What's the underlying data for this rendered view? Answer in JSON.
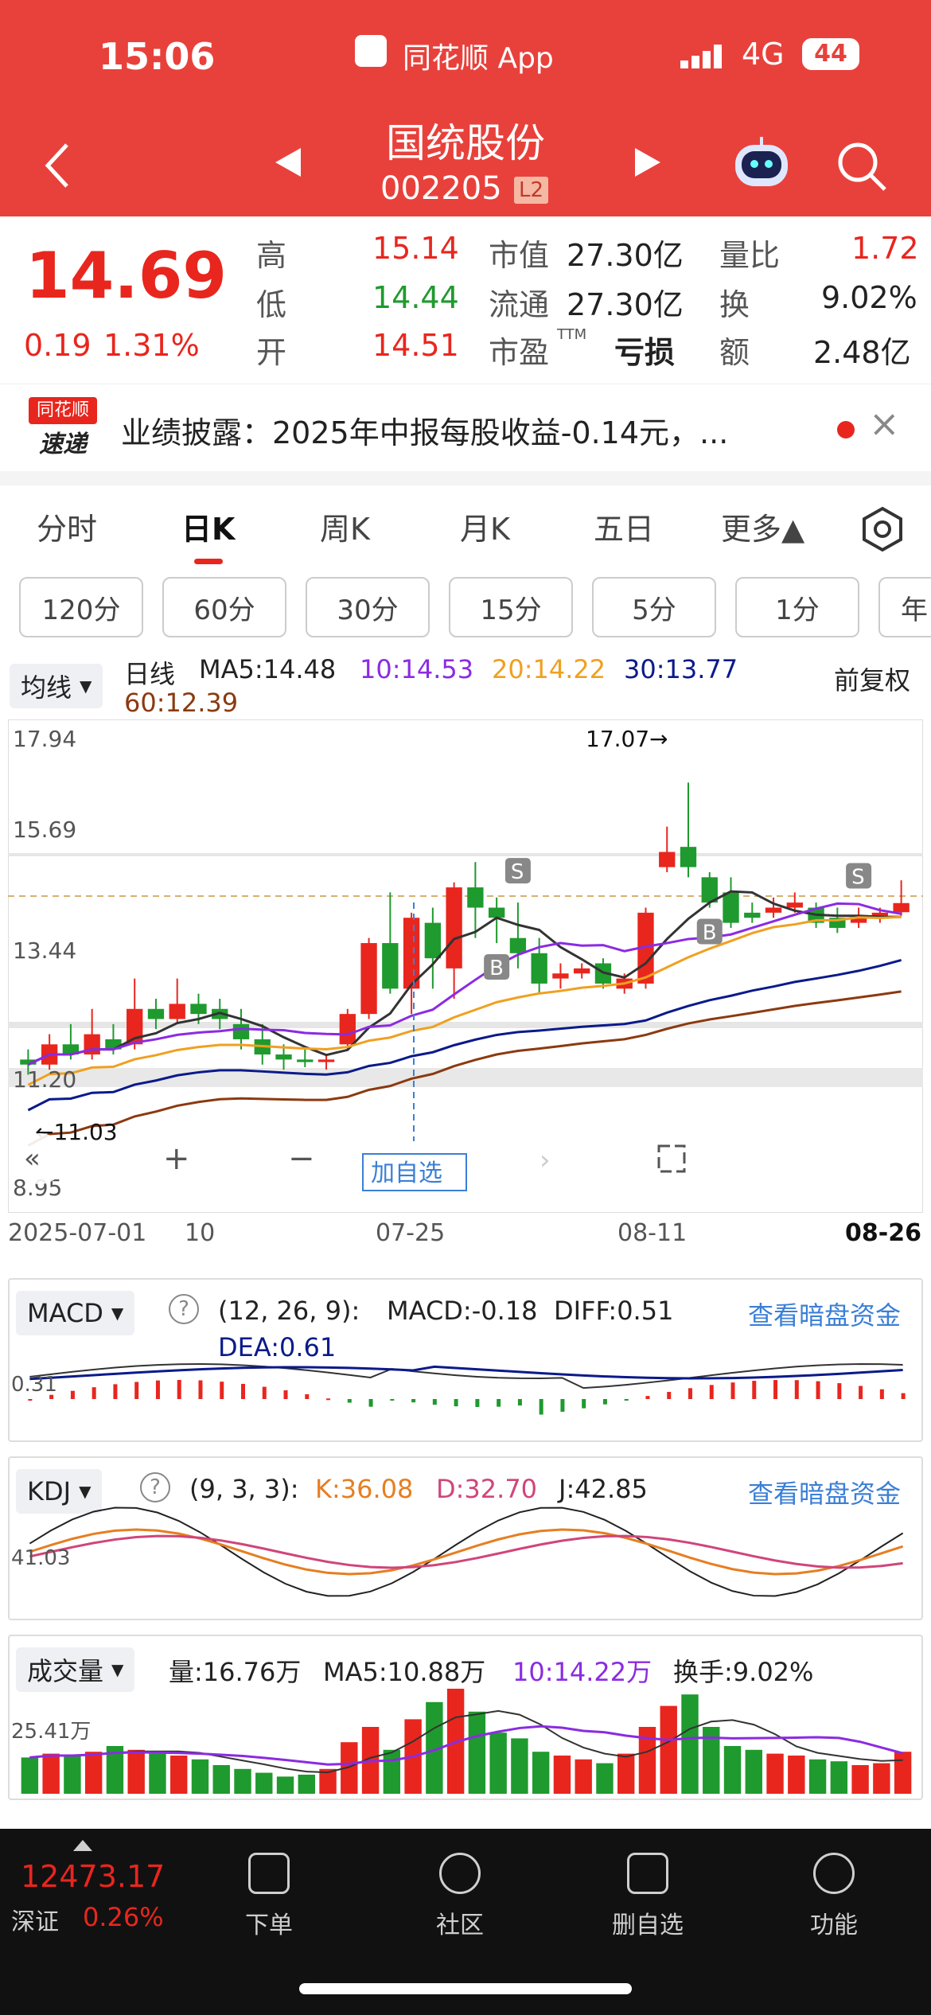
{
  "status": {
    "time": "15:06",
    "app": "同花顺 App",
    "network": "4G",
    "battery": "44"
  },
  "header": {
    "stock_name": "国统股份",
    "stock_code": "002205",
    "level": "L2"
  },
  "quote": {
    "price": "14.69",
    "change": "0.19",
    "change_pct": "1.31%",
    "high_label": "高",
    "high": "15.14",
    "low_label": "低",
    "low": "14.44",
    "open_label": "开",
    "open": "14.51",
    "mcap_label": "市值",
    "mcap": "27.30亿",
    "float_label": "流通",
    "float": "27.30亿",
    "pe_label": "市盈",
    "pe_sup": "TTM",
    "pe": "亏损",
    "vol_ratio_label": "量比",
    "vol_ratio": "1.72",
    "turnover_label": "换",
    "turnover": "9.02%",
    "amount_label": "额",
    "amount": "2.48亿"
  },
  "news": {
    "logo_top": "同花顺",
    "logo_bottom": "速递",
    "text": "业绩披露：2025年中报每股收益-0.14元，...",
    "close": "×"
  },
  "tabs": [
    "分时",
    "日K",
    "周K",
    "月K",
    "五日",
    "更多▲"
  ],
  "periods": [
    "120分",
    "60分",
    "30分",
    "15分",
    "5分",
    "1分",
    "年"
  ],
  "ma_bar": {
    "selector": "均线",
    "line": "日线",
    "ma5": "MA5:14.48",
    "ma10": "10:14.53",
    "ma20": "20:14.22",
    "ma30": "30:13.77",
    "ma60": "60:12.39",
    "adjust": "前复权"
  },
  "colors": {
    "up": "#e8261e",
    "down": "#1f9a2e",
    "ma5": "#333333",
    "ma10": "#8b2be2",
    "ma20": "#f0a020",
    "ma30": "#0a1a8a",
    "ma60": "#8b3a10",
    "header": "#e8413b"
  },
  "chart_data": {
    "type": "candlestick",
    "y_labels": [
      "17.94",
      "15.69",
      "13.44",
      "11.20",
      "8.95"
    ],
    "ylim": [
      8.95,
      17.94
    ],
    "x_labels": [
      "2025-07-01",
      "10",
      "07-25",
      "08-11",
      "08-26"
    ],
    "max_label": "17.07→",
    "min_label": "←11.03",
    "add_watch": "加自选",
    "markers": [
      {
        "text": "S",
        "idx": 23
      },
      {
        "text": "B",
        "idx": 22
      },
      {
        "text": "B",
        "idx": 32
      },
      {
        "text": "S",
        "idx": 39
      }
    ],
    "candles": [
      [
        11.6,
        11.5,
        11.8,
        11.3
      ],
      [
        11.5,
        11.9,
        12.1,
        11.4
      ],
      [
        11.9,
        11.7,
        12.3,
        11.6
      ],
      [
        11.7,
        12.1,
        12.6,
        11.6
      ],
      [
        12.0,
        11.8,
        12.3,
        11.7
      ],
      [
        11.9,
        12.6,
        13.2,
        11.8
      ],
      [
        12.6,
        12.4,
        12.8,
        12.2
      ],
      [
        12.4,
        12.7,
        13.2,
        12.3
      ],
      [
        12.7,
        12.5,
        12.9,
        12.3
      ],
      [
        12.6,
        12.4,
        12.8,
        12.2
      ],
      [
        12.3,
        12.0,
        12.6,
        11.8
      ],
      [
        12.0,
        11.7,
        12.3,
        11.5
      ],
      [
        11.7,
        11.6,
        11.9,
        11.4
      ],
      [
        11.6,
        11.55,
        11.8,
        11.45
      ],
      [
        11.55,
        11.6,
        11.7,
        11.4
      ],
      [
        11.9,
        12.5,
        12.6,
        11.8
      ],
      [
        12.5,
        13.9,
        14.0,
        12.4
      ],
      [
        13.9,
        13.0,
        14.9,
        12.9
      ],
      [
        13.0,
        14.4,
        14.5,
        12.5
      ],
      [
        14.3,
        13.6,
        14.6,
        13.0
      ],
      [
        13.4,
        15.0,
        15.1,
        12.8
      ],
      [
        15.0,
        14.6,
        15.5,
        14.0
      ],
      [
        14.6,
        14.4,
        14.8,
        13.9
      ],
      [
        14.0,
        13.7,
        14.7,
        13.4
      ],
      [
        13.7,
        13.1,
        14.0,
        12.9
      ],
      [
        13.2,
        13.3,
        13.5,
        13.0
      ],
      [
        13.3,
        13.4,
        13.5,
        13.2
      ],
      [
        13.5,
        13.1,
        13.6,
        13.0
      ],
      [
        13.0,
        13.2,
        13.3,
        12.9
      ],
      [
        13.1,
        14.5,
        14.6,
        13.0
      ],
      [
        15.4,
        15.7,
        16.2,
        15.3
      ],
      [
        15.8,
        15.4,
        17.07,
        15.2
      ],
      [
        15.2,
        14.7,
        15.3,
        14.6
      ],
      [
        14.9,
        14.3,
        15.2,
        14.2
      ],
      [
        14.5,
        14.4,
        14.7,
        14.3
      ],
      [
        14.5,
        14.6,
        14.8,
        14.4
      ],
      [
        14.6,
        14.7,
        14.9,
        14.5
      ],
      [
        14.6,
        14.3,
        14.7,
        14.2
      ],
      [
        14.4,
        14.2,
        14.6,
        14.1
      ],
      [
        14.3,
        14.4,
        14.6,
        14.2
      ],
      [
        14.4,
        14.5,
        14.6,
        14.3
      ],
      [
        14.51,
        14.69,
        15.14,
        14.44
      ]
    ]
  },
  "macd": {
    "name": "MACD",
    "params": "(12, 26, 9):",
    "macd": "MACD:-0.18",
    "diff": "DIFF:0.51",
    "dea": "DEA:0.61",
    "ylabel": "0.31",
    "link": "查看暗盘资金"
  },
  "kdj": {
    "name": "KDJ",
    "params": "(9, 3, 3):",
    "k": "K:36.08",
    "d": "D:32.70",
    "j": "J:42.85",
    "ylabel": "41.03",
    "link": "查看暗盘资金"
  },
  "vol": {
    "name": "成交量",
    "vol": "量:16.76万",
    "ma5": "MA5:10.88万",
    "ma10": "10:14.22万",
    "turnover": "换手:9.02%",
    "ylabel": "25.41万"
  },
  "bottom": {
    "index_value": "12473.17",
    "index_name": "深证",
    "index_pct": "0.26%",
    "items": [
      "下单",
      "社区",
      "删自选",
      "功能"
    ]
  }
}
